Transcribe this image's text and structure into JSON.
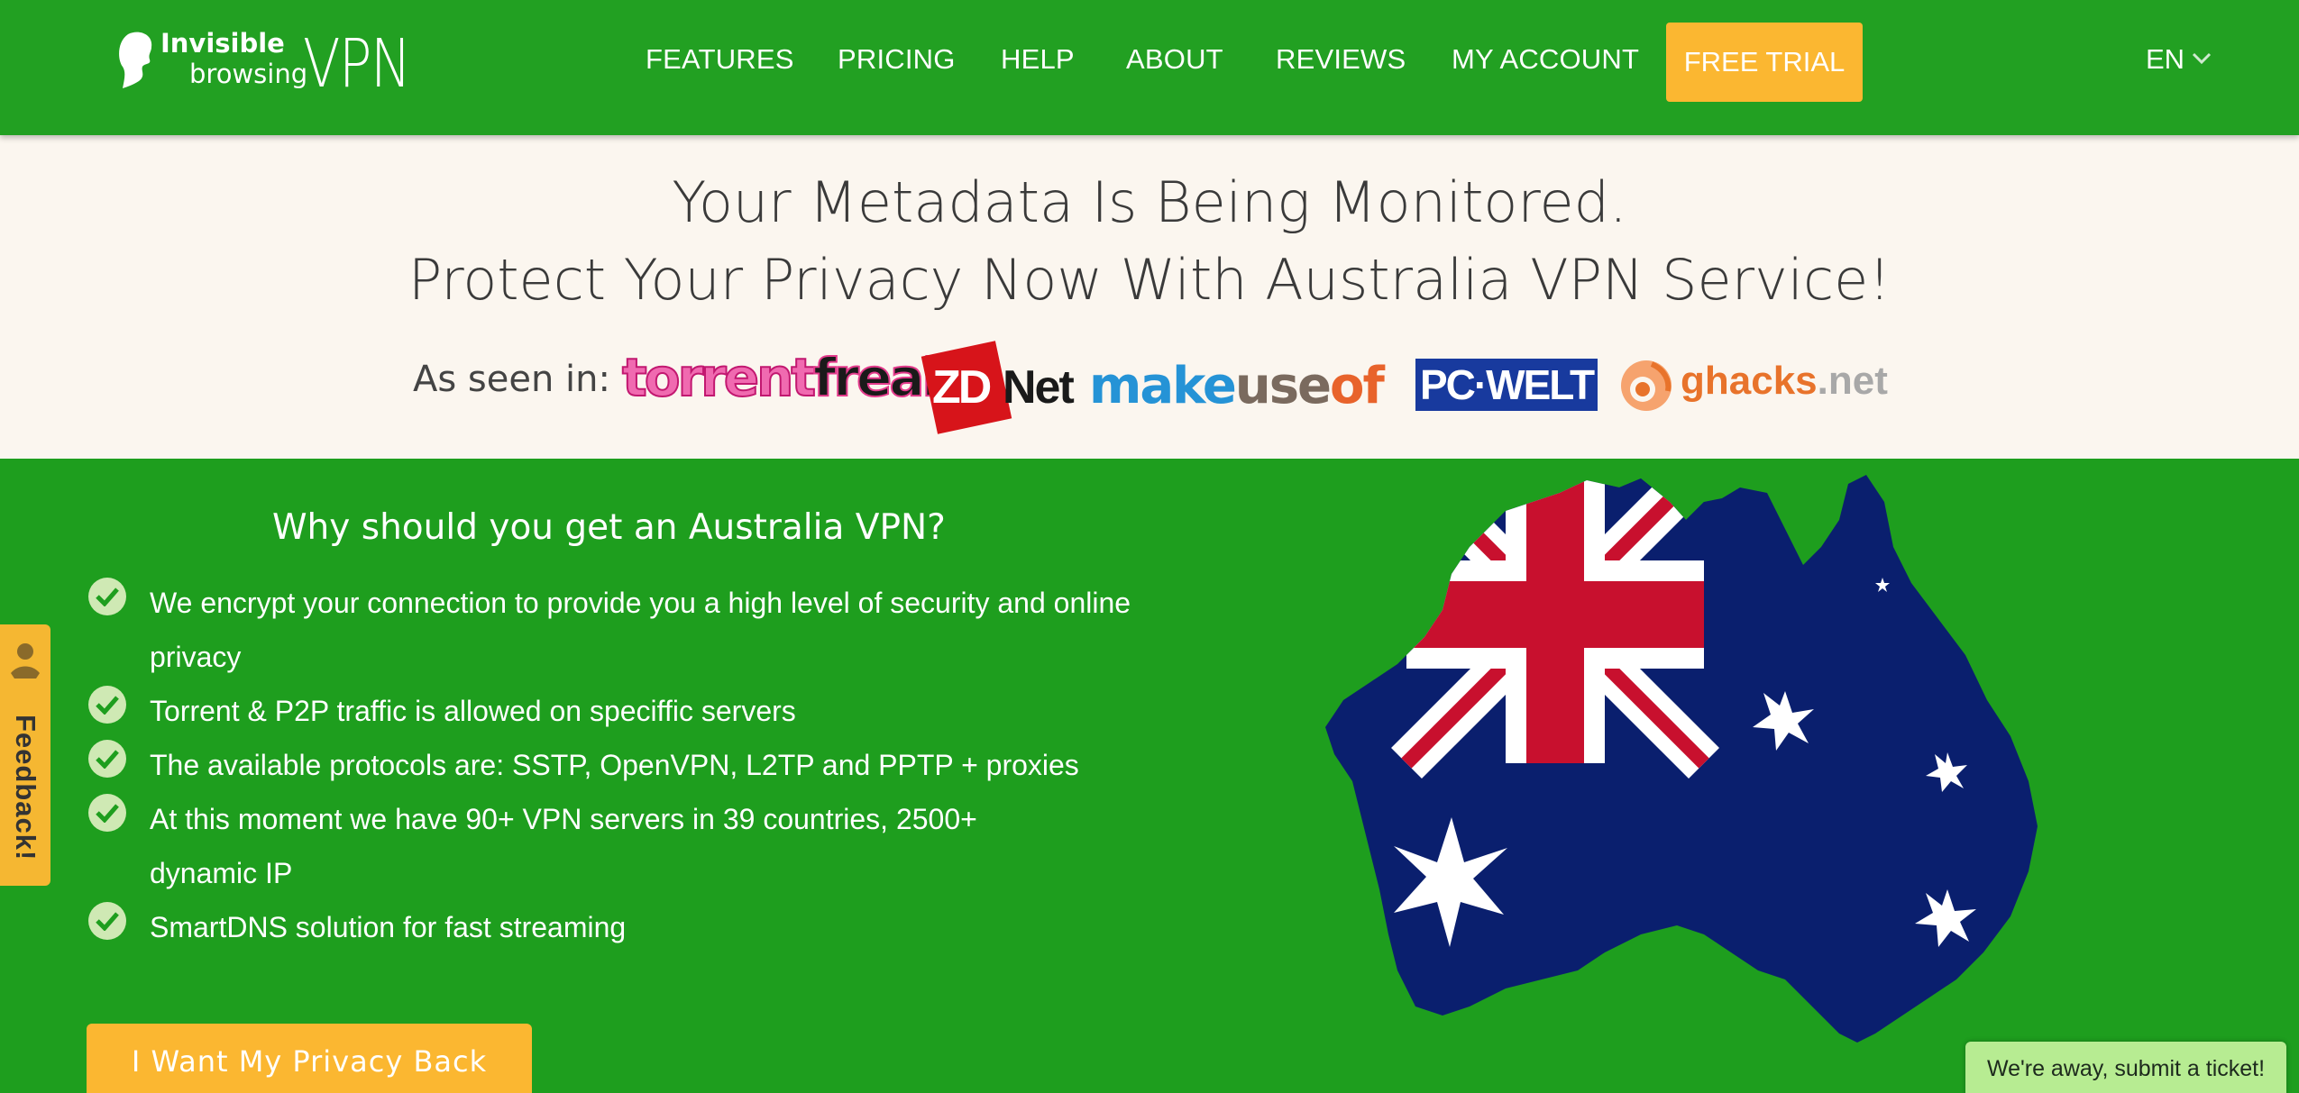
{
  "brand": {
    "line1": "Invisible",
    "line2": "browsing",
    "vpn": "VPN"
  },
  "nav": {
    "links": [
      "FEATURES",
      "PRICING",
      "HELP",
      "ABOUT",
      "REVIEWS",
      "MY ACCOUNT"
    ],
    "trial": "FREE TRIAL",
    "language": "EN"
  },
  "hero": {
    "line1": "Your Metadata Is Being Monitored.",
    "line2": "Protect Your Privacy Now With Australia VPN Service!",
    "seen_in": "As seen in:",
    "press": {
      "torrentfreak_a": "torrent",
      "torrentfreak_b": "freak",
      "zdnet_a": "ZD",
      "zdnet_b": "Net",
      "makeuseof_a": "make",
      "makeuseof_b": "use",
      "makeuseof_c": "of",
      "pcwelt": "PC·WELT",
      "ghacks_a": "ghacks",
      "ghacks_b": ".net"
    }
  },
  "main": {
    "heading": "Why should you get an Australia VPN?",
    "features": [
      "We encrypt your connection to provide you a high level of security and online privacy",
      "Torrent & P2P traffic is allowed on speciffic servers",
      "The available protocols are: SSTP, OpenVPN, L2TP and PPTP + proxies",
      "At this moment we have 90+ VPN servers in 39 countries, 2500+ dynamic IP",
      "SmartDNS solution for fast streaming"
    ],
    "cta": "I Want My Privacy Back"
  },
  "feedback": "Feedback!",
  "chat": "We're away, submit a ticket!",
  "colors": {
    "green": "#22a022",
    "orange": "#fbb731",
    "cream": "#fbf6ef"
  }
}
